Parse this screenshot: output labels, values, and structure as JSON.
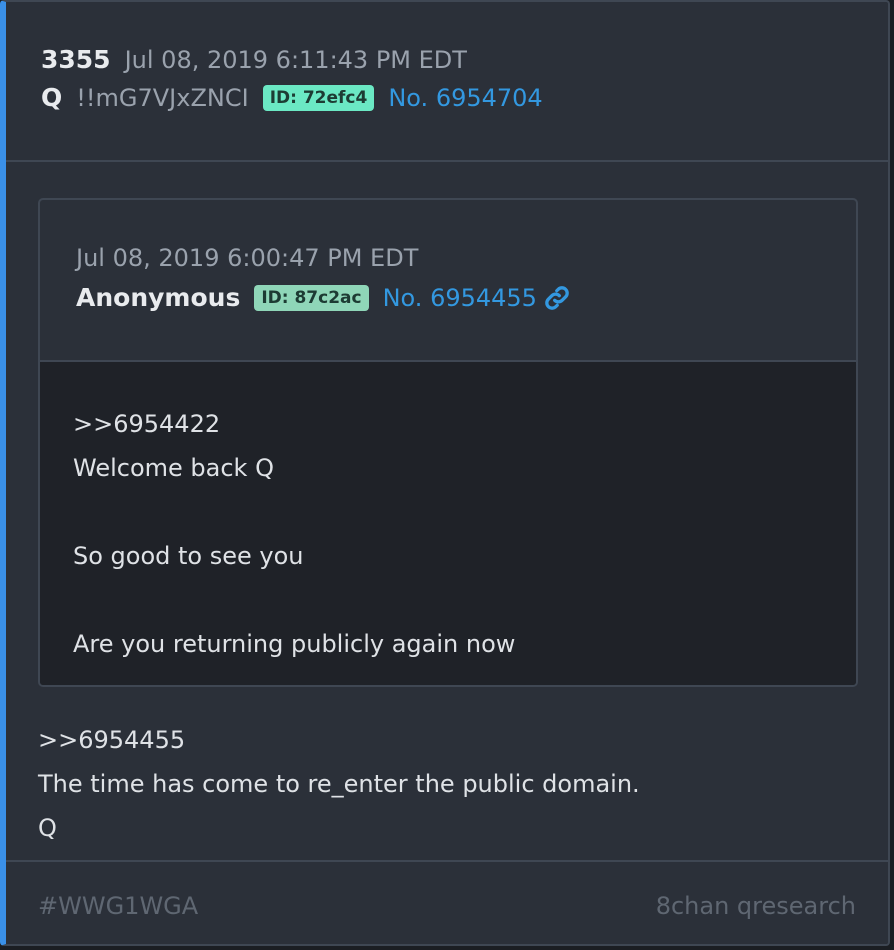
{
  "post": {
    "number": "3355",
    "date": "Jul 08, 2019 6:11:43 PM EDT",
    "author": "Q",
    "tripcode": "!!mG7VJxZNCI",
    "id_badge": "ID: 72efc4",
    "post_no": "No. 6954704",
    "body_lines": [
      ">>6954455",
      "The time has come to re_enter the public domain.",
      "Q"
    ]
  },
  "quoted": {
    "date": "Jul 08, 2019 6:00:47 PM EDT",
    "author": "Anonymous",
    "id_badge": "ID: 87c2ac",
    "post_no": "No. 6954455",
    "body_lines": [
      ">>6954422",
      "Welcome back Q",
      "",
      "So good to see you",
      "",
      "Are you returning publicly again now"
    ]
  },
  "footer": {
    "hashtag": "#WWG1WGA",
    "source": "8chan qresearch"
  },
  "icons": {
    "link": "link-icon"
  },
  "colors": {
    "accent_border": "#3a90e8",
    "post_link": "#3398e0",
    "id_q": "#6be8c4",
    "id_anon": "#8fd6b8"
  }
}
